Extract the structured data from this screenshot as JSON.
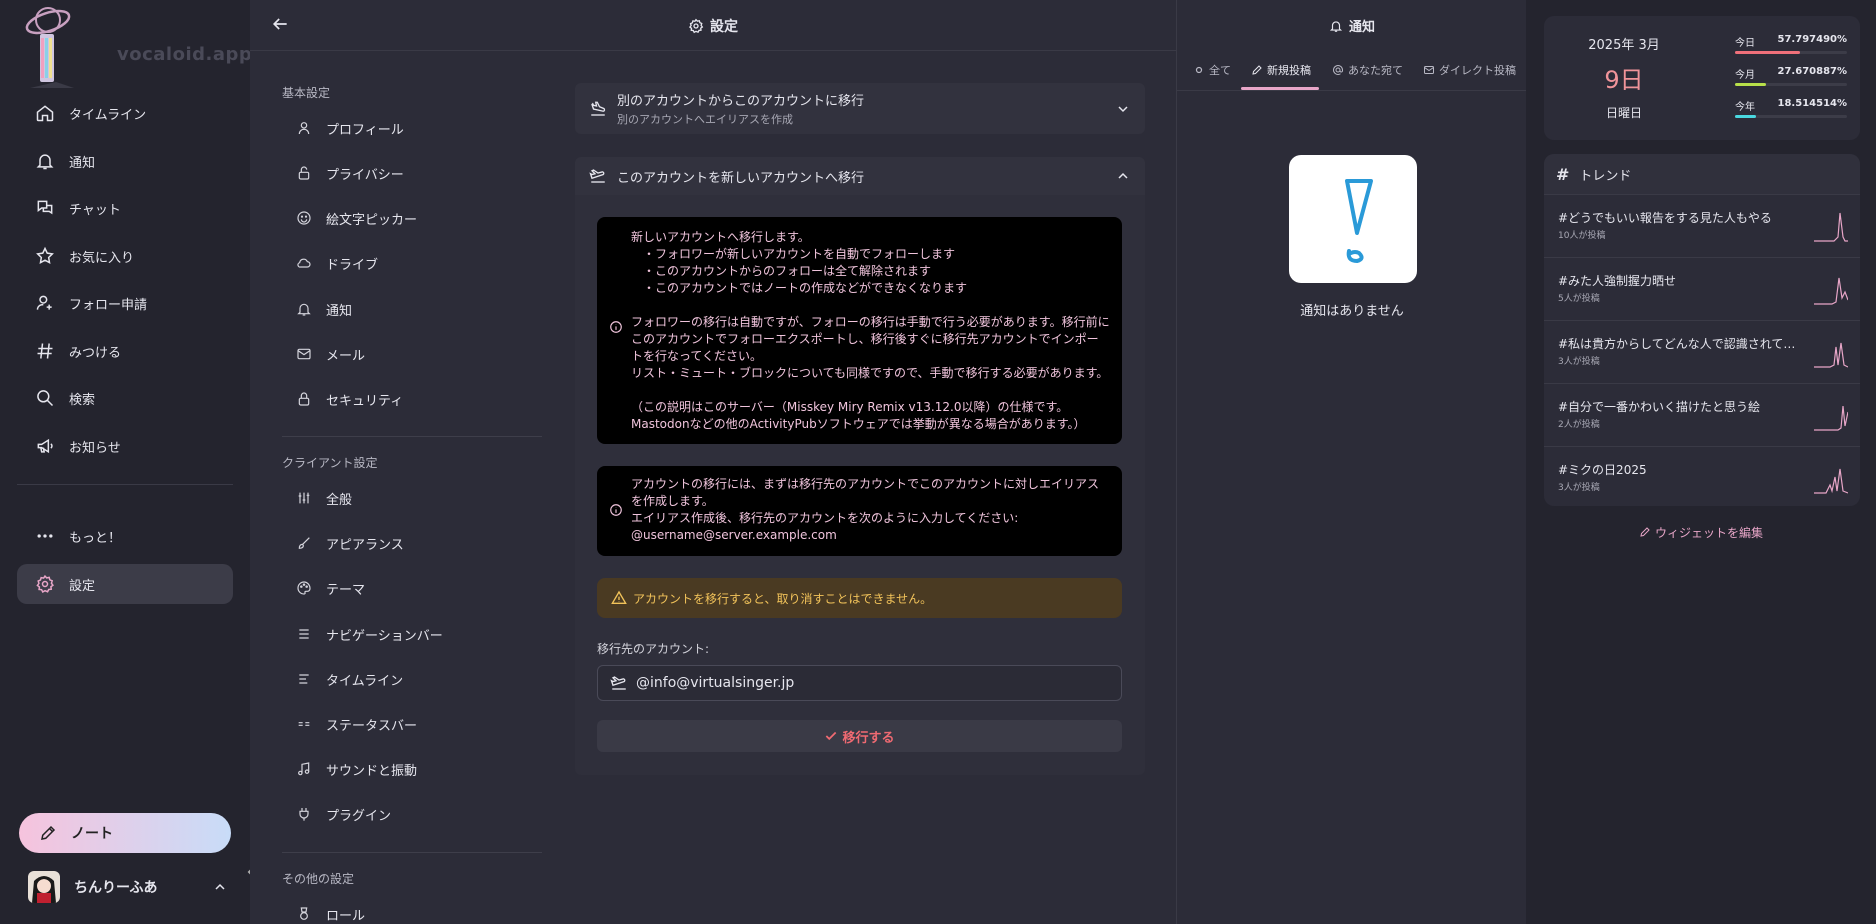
{
  "nav": {
    "logo_text": "vocaloid.app",
    "items": [
      {
        "label": "タイムライン",
        "icon": "home-icon"
      },
      {
        "label": "通知",
        "icon": "bell-icon"
      },
      {
        "label": "チャット",
        "icon": "chat-icon"
      },
      {
        "label": "お気に入り",
        "icon": "star-icon"
      },
      {
        "label": "フォロー申請",
        "icon": "user-plus-icon"
      },
      {
        "label": "みつける",
        "icon": "hash-icon"
      },
      {
        "label": "検索",
        "icon": "search-icon"
      },
      {
        "label": "お知らせ",
        "icon": "megaphone-icon"
      }
    ],
    "more_label": "もっと！",
    "settings_label": "設定",
    "note_button_label": "ノート",
    "account_name": "ちんりーふあ"
  },
  "settings": {
    "title": "設定",
    "sections": [
      {
        "title": "基本設定",
        "items": [
          "プロフィール",
          "プライバシー",
          "絵文字ピッカー",
          "ドライブ",
          "通知",
          "メール",
          "セキュリティ"
        ]
      },
      {
        "title": "クライアント設定",
        "items": [
          "全般",
          "アピアランス",
          "テーマ",
          "ナビゲーションバー",
          "タイムライン",
          "ステータスバー",
          "サウンドと振動",
          "プラグイン"
        ]
      },
      {
        "title": "その他の設定",
        "items": [
          "ロール"
        ]
      }
    ],
    "fold1": {
      "title": "別のアカウントからこのアカウントに移行",
      "subtitle": "別のアカウントへエイリアスを作成"
    },
    "fold2": {
      "title": "このアカウントを新しいアカウントへ移行"
    },
    "info1": "新しいアカウントへ移行します。\n　・フォロワーが新しいアカウントを自動でフォローします\n　・このアカウントからのフォローは全て解除されます\n　・このアカウントではノートの作成などができなくなります\n\nフォロワーの移行は自動ですが、フォローの移行は手動で行う必要があります。移行前にこのアカウントでフォローエクスポートし、移行後すぐに移行先アカウントでインポートを行なってください。\nリスト・ミュート・ブロックについても同様ですので、手動で移行する必要があります。\n\n（この説明はこのサーバー（Misskey Miry Remix v13.12.0以降）の仕様です。Mastodonなどの他のActivityPubソフトウェアでは挙動が異なる場合があります。）",
    "info2": "アカウントの移行には、まずは移行先のアカウントでこのアカウントに対しエイリアスを作成します。\nエイリアス作成後、移行先のアカウントを次のように入力してください: @username@server.example.com",
    "warning": "アカウントを移行すると、取り消すことはできません。",
    "target_label": "移行先のアカウント:",
    "target_value": "@info@virtualsinger.jp",
    "migrate_button": "移行する"
  },
  "notifications": {
    "title": "通知",
    "tabs": [
      "全て",
      "新規投稿",
      "あなた宛て",
      "ダイレクト投稿"
    ],
    "active_tab": "新規投稿",
    "empty_text": "通知はありません"
  },
  "widgets": {
    "calendar": {
      "year_month": "2025年 3月",
      "day": "9日",
      "weekday": "日曜日",
      "rows": [
        {
          "label": "今日",
          "value": "57.797490%",
          "progress": 0.578,
          "color": "#f0707a"
        },
        {
          "label": "今月",
          "value": "27.670887%",
          "progress": 0.277,
          "color": "#b8e04a"
        },
        {
          "label": "今年",
          "value": "18.514514%",
          "progress": 0.185,
          "color": "#4ad8e0"
        }
      ]
    },
    "trends": {
      "title": "トレンド",
      "items": [
        {
          "tag": "#どうでもいい報告をする見た人もやる",
          "count": "10人が投稿"
        },
        {
          "tag": "#みた人強制握力晒せ",
          "count": "5人が投稿"
        },
        {
          "tag": "#私は貴方からしてどんな人で認識されてるの…",
          "count": "3人が投稿"
        },
        {
          "tag": "#自分で一番かわいく描けたと思う絵",
          "count": "2人が投稿"
        },
        {
          "tag": "#ミクの日2025",
          "count": "3人が投稿"
        }
      ]
    },
    "edit_label": "ウィジェットを編集"
  },
  "colors": {
    "accent": "#e8a6c8",
    "danger": "#f06a72",
    "warning": "#f2c35a"
  }
}
